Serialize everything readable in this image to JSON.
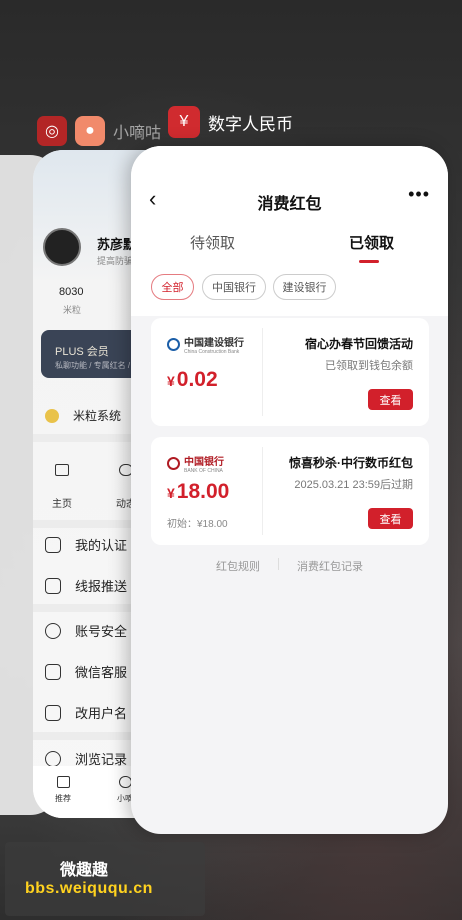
{
  "apps": {
    "back_app_name": "小嘀咕",
    "front_app_name": "数字人民币"
  },
  "card_middle": {
    "user_name": "苏彦默",
    "user_sub": "提高防骗",
    "stat_value": "8030",
    "stat_label": "米粒",
    "plus_title": "PLUS 会员",
    "plus_sub": "私聊功能 / 专属红名 / ",
    "rice_system": "米粒系统",
    "nav_home": "主页",
    "nav_dynamic": "动态",
    "menu": [
      "我的认证",
      "线报推送",
      "账号安全",
      "微信客服",
      "改用户名",
      "浏览记录"
    ],
    "bottom_nav": [
      "推荐",
      "小嘀"
    ]
  },
  "card_front": {
    "title": "消费红包",
    "tabs": [
      "待领取",
      "已领取"
    ],
    "active_tab": 1,
    "chips": [
      "全部",
      "中国银行",
      "建设银行"
    ],
    "active_chip": 0,
    "packets": [
      {
        "bank": "中国建设银行",
        "bank_en": "China Construction Bank",
        "currency": "¥",
        "amount": "0.02",
        "title": "宿心办春节回馈活动",
        "subtitle": "已领取到钱包余额",
        "button": "查看",
        "initial": ""
      },
      {
        "bank": "中国银行",
        "bank_en": "BANK OF CHINA",
        "currency": "¥",
        "amount": "18.00",
        "title": "惊喜秒杀·中行数币红包",
        "subtitle": "2025.03.21 23:59后过期",
        "button": "查看",
        "initial": "初始：¥18.00"
      }
    ],
    "links": [
      "红包规则",
      "消费红包记录"
    ]
  },
  "watermark": {
    "line1": "微趣趣",
    "line2": "bbs.weiququ.cn"
  },
  "colors": {
    "accent": "#d2202b",
    "ccb_blue": "#1b5ea8",
    "boc_red": "#b01b23"
  }
}
